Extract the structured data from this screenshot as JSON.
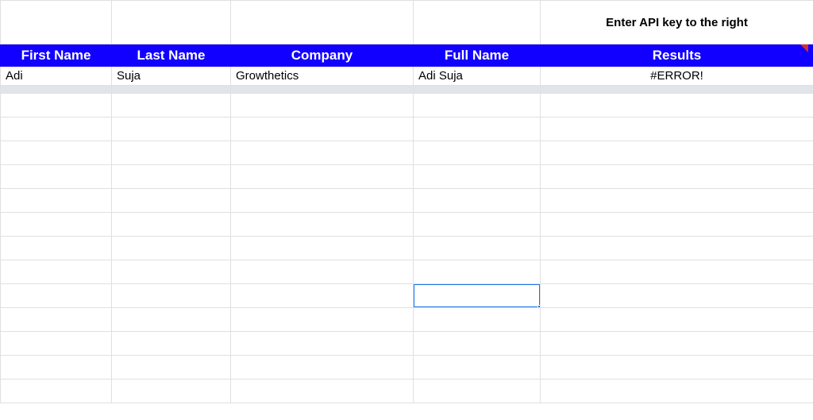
{
  "instruction": "Enter API key to the right",
  "headers": {
    "first_name": "First Name",
    "last_name": "Last Name",
    "company": "Company",
    "full_name": "Full Name",
    "results": "Results"
  },
  "rows": [
    {
      "first_name": "Adi",
      "last_name": "Suja",
      "company": "Growthetics",
      "full_name": "Adi Suja",
      "results": "#ERROR!"
    }
  ],
  "selected_cell": {
    "row": 10,
    "col": 3
  },
  "empty_row_count": 13
}
